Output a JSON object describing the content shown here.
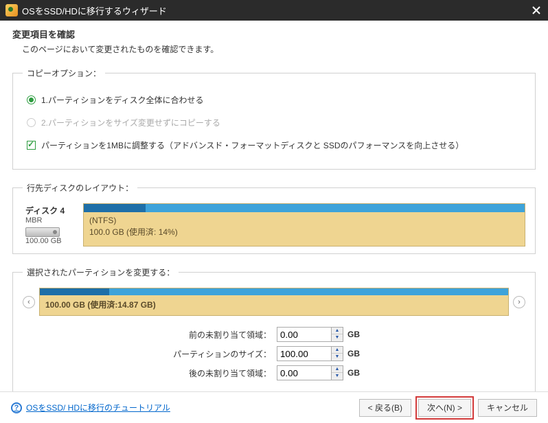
{
  "window": {
    "title": "OSをSSD/HDに移行するウィザード"
  },
  "header": {
    "heading": "変更項目を確認",
    "sub": "このページにおいて変更されたものを確認できます。"
  },
  "copy": {
    "legend": "コピーオプション：",
    "opt1": "1.パーティションをディスク全体に合わせる",
    "opt2": "2.パーティションをサイズ変更せずにコピーする",
    "align": "パーティションを1MBに調整する（アドバンスド・フォーマットディスクと SSDのパフォーマンスを向上させる）"
  },
  "dest": {
    "legend": "行先ディスクのレイアウト：",
    "disk_name": "ディスク 4",
    "disk_scheme": "MBR",
    "disk_size": "100.00 GB",
    "part_fs": "(NTFS)",
    "part_detail": "100.0 GB (使用済: 14%)"
  },
  "selected": {
    "legend": "選択されたパーティションを変更する：",
    "detail": "100.00 GB (使用済:14.87 GB)"
  },
  "sizes": {
    "before_label": "前の未割り当て領域：",
    "before_value": "0.00",
    "part_label": "パーティションのサイズ：",
    "part_value": "100.00",
    "after_label": "後の未割り当て領域：",
    "after_value": "0.00",
    "unit": "GB"
  },
  "footer": {
    "help": "OSをSSD/ HDに移行のチュートリアル",
    "back": "< 戻る(B)",
    "next": "次へ(N) >",
    "cancel": "キャンセル"
  }
}
